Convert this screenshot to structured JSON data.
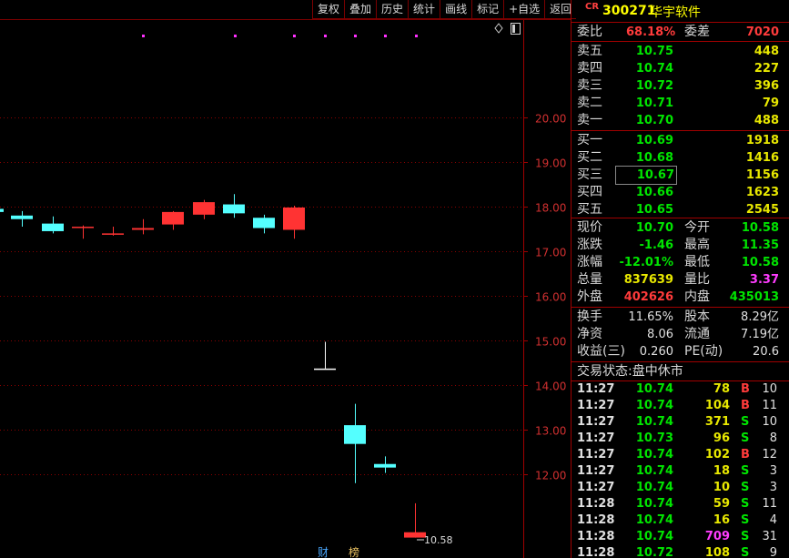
{
  "toolbar": [
    "复权",
    "叠加",
    "历史",
    "统计",
    "画线",
    "标记",
    "+自选",
    "返回"
  ],
  "stock": {
    "tag": "CR",
    "code": "300271",
    "name": "华宇软件"
  },
  "weibi": {
    "label": "委比",
    "value": "68.18%",
    "label2": "委差",
    "value2": "7020"
  },
  "asks": [
    {
      "label": "卖五",
      "price": "10.75",
      "vol": "448"
    },
    {
      "label": "卖四",
      "price": "10.74",
      "vol": "227"
    },
    {
      "label": "卖三",
      "price": "10.72",
      "vol": "396"
    },
    {
      "label": "卖二",
      "price": "10.71",
      "vol": "79"
    },
    {
      "label": "卖一",
      "price": "10.70",
      "vol": "488"
    }
  ],
  "bids": [
    {
      "label": "买一",
      "price": "10.69",
      "vol": "1918"
    },
    {
      "label": "买二",
      "price": "10.68",
      "vol": "1416"
    },
    {
      "label": "买三",
      "price": "10.67",
      "vol": "1156"
    },
    {
      "label": "买四",
      "price": "10.66",
      "vol": "1623"
    },
    {
      "label": "买五",
      "price": "10.65",
      "vol": "2545"
    }
  ],
  "quote": [
    {
      "l1": "现价",
      "v1": "10.70",
      "c1": "green",
      "l2": "今开",
      "v2": "10.58",
      "c2": "green"
    },
    {
      "l1": "涨跌",
      "v1": "-1.46",
      "c1": "green",
      "l2": "最高",
      "v2": "11.35",
      "c2": "green"
    },
    {
      "l1": "涨幅",
      "v1": "-12.01%",
      "c1": "green",
      "l2": "最低",
      "v2": "10.58",
      "c2": "green"
    },
    {
      "l1": "总量",
      "v1": "837639",
      "c1": "yellow",
      "l2": "量比",
      "v2": "3.37",
      "c2": "magenta"
    },
    {
      "l1": "外盘",
      "v1": "402626",
      "c1": "red",
      "l2": "内盘",
      "v2": "435013",
      "c2": "green"
    }
  ],
  "fundamentals": [
    {
      "l1": "换手",
      "v1": "11.65%",
      "l2": "股本",
      "v2": "8.29亿"
    },
    {
      "l1": "净资",
      "v1": "8.06",
      "l2": "流通",
      "v2": "7.19亿"
    },
    {
      "l1": "收益(三)",
      "v1": "0.260",
      "l2": "PE(动)",
      "v2": "20.6"
    }
  ],
  "status": "交易状态:盘中休市",
  "ticks": [
    {
      "time": "11:27",
      "price": "10.74",
      "vol": "78",
      "side": "B",
      "n": "10"
    },
    {
      "time": "11:27",
      "price": "10.74",
      "vol": "104",
      "side": "B",
      "n": "11"
    },
    {
      "time": "11:27",
      "price": "10.74",
      "vol": "371",
      "side": "S",
      "n": "10"
    },
    {
      "time": "11:27",
      "price": "10.73",
      "vol": "96",
      "side": "S",
      "n": "8"
    },
    {
      "time": "11:27",
      "price": "10.74",
      "vol": "102",
      "side": "B",
      "n": "12"
    },
    {
      "time": "11:27",
      "price": "10.74",
      "vol": "18",
      "side": "S",
      "n": "3"
    },
    {
      "time": "11:27",
      "price": "10.74",
      "vol": "10",
      "side": "S",
      "n": "3"
    },
    {
      "time": "11:28",
      "price": "10.74",
      "vol": "59",
      "side": "S",
      "n": "11"
    },
    {
      "time": "11:28",
      "price": "10.74",
      "vol": "16",
      "side": "S",
      "n": "4"
    },
    {
      "time": "11:28",
      "price": "10.74",
      "vol": "709",
      "side": "S",
      "n": "31"
    },
    {
      "time": "11:28",
      "price": "10.72",
      "vol": "108",
      "side": "S",
      "n": "9"
    }
  ],
  "chart_data": {
    "type": "candlestick",
    "y_ticks": [
      "20.00",
      "19.00",
      "18.00",
      "17.00",
      "16.00",
      "15.00",
      "14.00",
      "13.00",
      "12.00"
    ],
    "y_values": [
      20,
      19,
      18,
      17,
      16,
      15,
      14,
      13,
      12
    ],
    "ylim": [
      10.33,
      20.5
    ],
    "candles": [
      {
        "o": 17.95,
        "h": 18.02,
        "l": 17.85,
        "c": 17.88,
        "color": "cyan"
      },
      {
        "o": 17.8,
        "h": 17.9,
        "l": 17.55,
        "c": 17.72,
        "color": "cyan"
      },
      {
        "o": 17.62,
        "h": 17.78,
        "l": 17.4,
        "c": 17.45,
        "color": "cyan"
      },
      {
        "o": 17.53,
        "h": 17.58,
        "l": 17.28,
        "c": 17.55,
        "color": "red"
      },
      {
        "o": 17.38,
        "h": 17.55,
        "l": 17.35,
        "c": 17.4,
        "color": "red"
      },
      {
        "o": 17.48,
        "h": 17.72,
        "l": 17.38,
        "c": 17.52,
        "color": "red"
      },
      {
        "o": 17.6,
        "h": 17.9,
        "l": 17.48,
        "c": 17.88,
        "color": "red"
      },
      {
        "o": 17.82,
        "h": 18.15,
        "l": 17.72,
        "c": 18.1,
        "color": "red"
      },
      {
        "o": 18.05,
        "h": 18.28,
        "l": 17.75,
        "c": 17.85,
        "color": "cyan"
      },
      {
        "o": 17.75,
        "h": 17.82,
        "l": 17.4,
        "c": 17.52,
        "color": "cyan"
      },
      {
        "o": 17.48,
        "h": 18.02,
        "l": 17.28,
        "c": 17.98,
        "color": "red"
      },
      {
        "o": 14.37,
        "h": 14.97,
        "l": 14.37,
        "c": 14.37,
        "color": "white"
      },
      {
        "o": 13.1,
        "h": 13.58,
        "l": 11.8,
        "c": 12.68,
        "color": "cyan"
      },
      {
        "o": 12.23,
        "h": 12.4,
        "l": 12.03,
        "c": 12.15,
        "color": "cyan"
      },
      {
        "o": 10.58,
        "h": 11.35,
        "l": 10.58,
        "c": 10.7,
        "color": "red"
      }
    ],
    "low_label": "10.58",
    "markers": [
      "财",
      "榜"
    ]
  }
}
